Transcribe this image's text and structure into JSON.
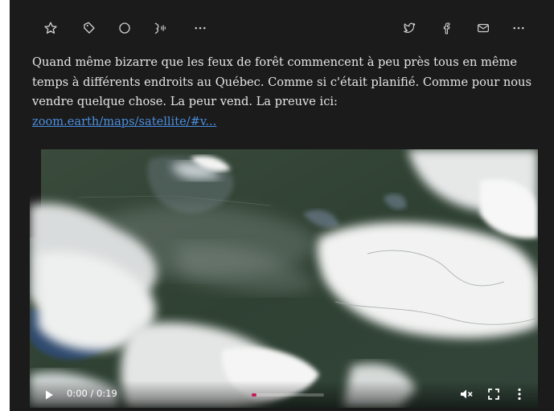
{
  "toolbar": {
    "left_icons": [
      "star-icon",
      "tag-icon",
      "circle-icon",
      "speak-icon",
      "more-icon"
    ],
    "right_icons": [
      "twitter-icon",
      "facebook-icon",
      "mail-icon",
      "more-icon"
    ]
  },
  "post": {
    "text": "Quand même bizarre que les feux de forêt commencent à peu près tous en même temps à différents endroits au Québec. Comme si c'était planifié. Comme pour nous vendre quelque chose. La peur vend. La preuve ici:",
    "link": "zoom.earth/maps/satellite/#v..."
  },
  "video": {
    "time": "0:00 / 0:19",
    "progress": 0.0
  },
  "colors": {
    "background": "#1b1b1b",
    "text": "#e6e6e6",
    "link": "#4a8fe0",
    "accent": "#c9185b"
  }
}
